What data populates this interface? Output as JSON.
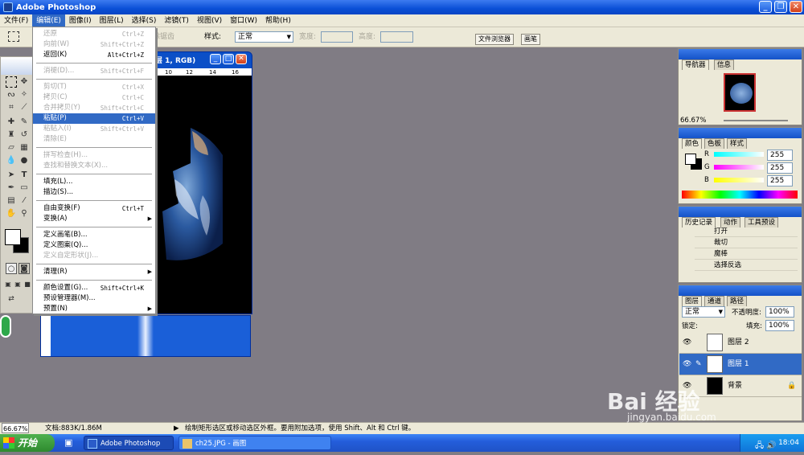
{
  "app": {
    "title": "Adobe Photoshop"
  },
  "menubar": [
    "文件(F)",
    "编辑(E)",
    "图像(I)",
    "图层(L)",
    "选择(S)",
    "滤镜(T)",
    "视图(V)",
    "窗口(W)",
    "帮助(H)"
  ],
  "options": {
    "feather_label": "除锯齿",
    "style_label": "样式:",
    "style_value": "正常",
    "width_label": "宽度:",
    "height_label": "高度:",
    "tab_browser": "文件浏览器",
    "tab_brushes": "画笔"
  },
  "document": {
    "title": "层 1, RGB)",
    "ruler": [
      "10",
      "12",
      "14",
      "16"
    ]
  },
  "edit_menu": [
    {
      "label": "还原",
      "shortcut": "Ctrl+Z",
      "disabled": true
    },
    {
      "label": "向前(W)",
      "shortcut": "Shift+Ctrl+Z",
      "disabled": true
    },
    {
      "label": "返回(K)",
      "shortcut": "Alt+Ctrl+Z",
      "disabled": false
    },
    {
      "label": "消褪(D)...",
      "shortcut": "Shift+Ctrl+F",
      "disabled": true
    },
    {
      "label": "剪切(T)",
      "shortcut": "Ctrl+X",
      "disabled": true
    },
    {
      "label": "拷贝(C)",
      "shortcut": "Ctrl+C",
      "disabled": true
    },
    {
      "label": "合并拷贝(Y)",
      "shortcut": "Shift+Ctrl+C",
      "disabled": true
    },
    {
      "label": "粘贴(P)",
      "shortcut": "Ctrl+V",
      "disabled": false,
      "highlighted": true
    },
    {
      "label": "粘贴入(I)",
      "shortcut": "Shift+Ctrl+V",
      "disabled": true
    },
    {
      "label": "清除(E)",
      "shortcut": "",
      "disabled": true
    },
    {
      "label": "拼写检查(H)...",
      "shortcut": "",
      "disabled": true
    },
    {
      "label": "查找和替换文本(X)...",
      "shortcut": "",
      "disabled": true
    },
    {
      "label": "填充(L)...",
      "shortcut": "",
      "disabled": false
    },
    {
      "label": "描边(S)...",
      "shortcut": "",
      "disabled": false
    },
    {
      "label": "自由变换(F)",
      "shortcut": "Ctrl+T",
      "disabled": false
    },
    {
      "label": "变换(A)",
      "shortcut": "",
      "disabled": false,
      "submenu": true
    },
    {
      "label": "定义画笔(B)...",
      "shortcut": "",
      "disabled": false
    },
    {
      "label": "定义图案(Q)...",
      "shortcut": "",
      "disabled": false
    },
    {
      "label": "定义自定形状(J)...",
      "shortcut": "",
      "disabled": true
    },
    {
      "label": "清理(R)",
      "shortcut": "",
      "disabled": false,
      "submenu": true
    },
    {
      "label": "颜色设置(G)...",
      "shortcut": "Shift+Ctrl+K",
      "disabled": false
    },
    {
      "label": "预设管理器(M)...",
      "shortcut": "",
      "disabled": false
    },
    {
      "label": "预置(N)",
      "shortcut": "",
      "disabled": false,
      "submenu": true
    }
  ],
  "navigator": {
    "tabs": [
      "导航器",
      "信息"
    ],
    "zoom": "66.67%"
  },
  "color_panel": {
    "tabs": [
      "颜色",
      "色板",
      "样式"
    ],
    "r_label": "R",
    "g_label": "G",
    "b_label": "B",
    "r": "255",
    "g": "255",
    "b": "255"
  },
  "history": {
    "tabs": [
      "历史记录",
      "动作",
      "工具预设"
    ],
    "items": [
      "打开",
      "裁切",
      "魔棒",
      "选择反选"
    ]
  },
  "layers": {
    "tabs": [
      "图层",
      "通道",
      "路径"
    ],
    "blend_mode": "正常",
    "opacity_label": "不透明度:",
    "opacity": "100%",
    "lock_label": "锁定:",
    "fill_label": "填充:",
    "fill": "100%",
    "items": [
      {
        "name": "图层 2",
        "selected": false
      },
      {
        "name": "图层 1",
        "selected": true
      },
      {
        "name": "背景",
        "selected": false
      }
    ]
  },
  "status": {
    "zoom": "66.67%",
    "doc_info": "文档:883K/1.86M",
    "hint": "绘制矩形选区或移动选区外框。要用附加选项，使用 Shift、Alt 和 Ctrl 键。"
  },
  "taskbar": {
    "start": "开始",
    "items": [
      "Adobe Photoshop",
      "ch25.JPG - 画图"
    ],
    "clock": "18:04"
  },
  "watermark": {
    "brand": "Bai 经验",
    "url": "jingyan.baidu.com"
  }
}
